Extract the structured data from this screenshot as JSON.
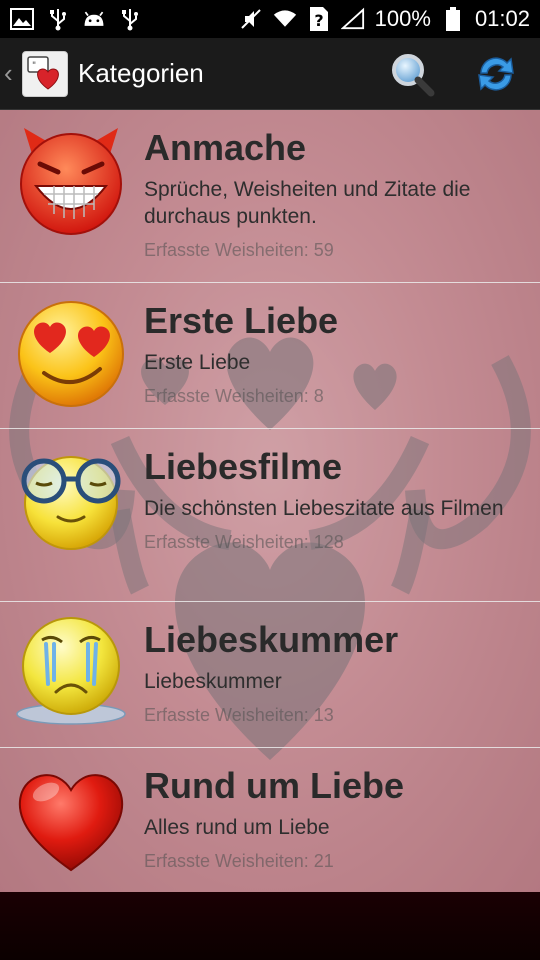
{
  "status_bar": {
    "left_icons": [
      "image-icon",
      "usb-icon",
      "android-icon",
      "usb-icon"
    ],
    "right_icons": [
      "mute-icon",
      "wifi-icon",
      "sim-unknown-icon",
      "signal-icon"
    ],
    "battery": "100%",
    "time": "01:02"
  },
  "action_bar": {
    "title": "Kategorien",
    "actions": [
      "search-icon",
      "refresh-icon"
    ]
  },
  "categories": [
    {
      "title": "Anmache",
      "description": "Sprüche, Weisheiten und Zitate die durchaus punkten.",
      "count": "Erfasste Weisheiten: 59",
      "icon": "devil-grin-icon"
    },
    {
      "title": "Erste Liebe",
      "description": "Erste Liebe",
      "count": "Erfasste Weisheiten: 8",
      "icon": "heart-eyes-icon"
    },
    {
      "title": "Liebesfilme",
      "description": "Die schönsten Liebeszitate aus Filmen",
      "count": "Erfasste Weisheiten: 128",
      "icon": "glasses-smiley-icon"
    },
    {
      "title": "Liebeskummer",
      "description": "Liebeskummer",
      "count": "Erfasste Weisheiten: 13",
      "icon": "crying-smiley-icon"
    },
    {
      "title": "Rund um Liebe",
      "description": "Alles rund um Liebe",
      "count": "Erfasste Weisheiten: 21",
      "icon": "red-heart-icon"
    }
  ]
}
